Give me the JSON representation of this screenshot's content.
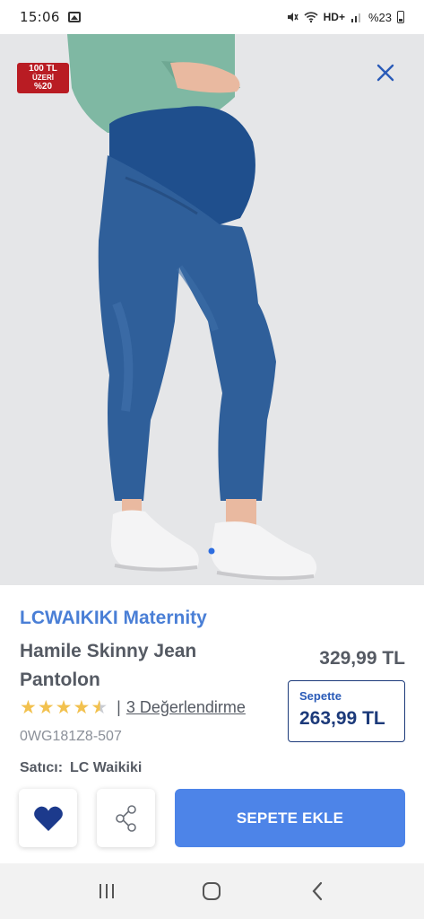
{
  "status_bar": {
    "time": "15:06",
    "network": "HD+",
    "battery": "%23"
  },
  "badge": {
    "line1": "100 TL",
    "line2": "ÜZERİ",
    "line3": "%20"
  },
  "product": {
    "brand": "LCWAIKIKI Maternity",
    "name": "Hamile Skinny Jean Pantolon",
    "price": "329,99 TL",
    "basket_label": "Sepette",
    "basket_price": "263,99 TL",
    "rating": 4.5,
    "reviews": "3 Değerlendirme",
    "sku": "0WG181Z8-507",
    "seller_label": "Satıcı:",
    "seller_name": "LC Waikiki"
  },
  "actions": {
    "add_to_cart": "SEPETE EKLE"
  },
  "icons": {
    "close": "close-icon",
    "favorite": "heart-icon",
    "share": "share-icon",
    "recents": "recents-icon",
    "home": "home-icon",
    "back": "back-icon"
  },
  "colors": {
    "brand_blue": "#4a7fd6",
    "button_blue": "#4d84e8",
    "badge_red": "#b91c23",
    "basket_navy": "#1c3a7a",
    "star": "#f2c14e"
  }
}
